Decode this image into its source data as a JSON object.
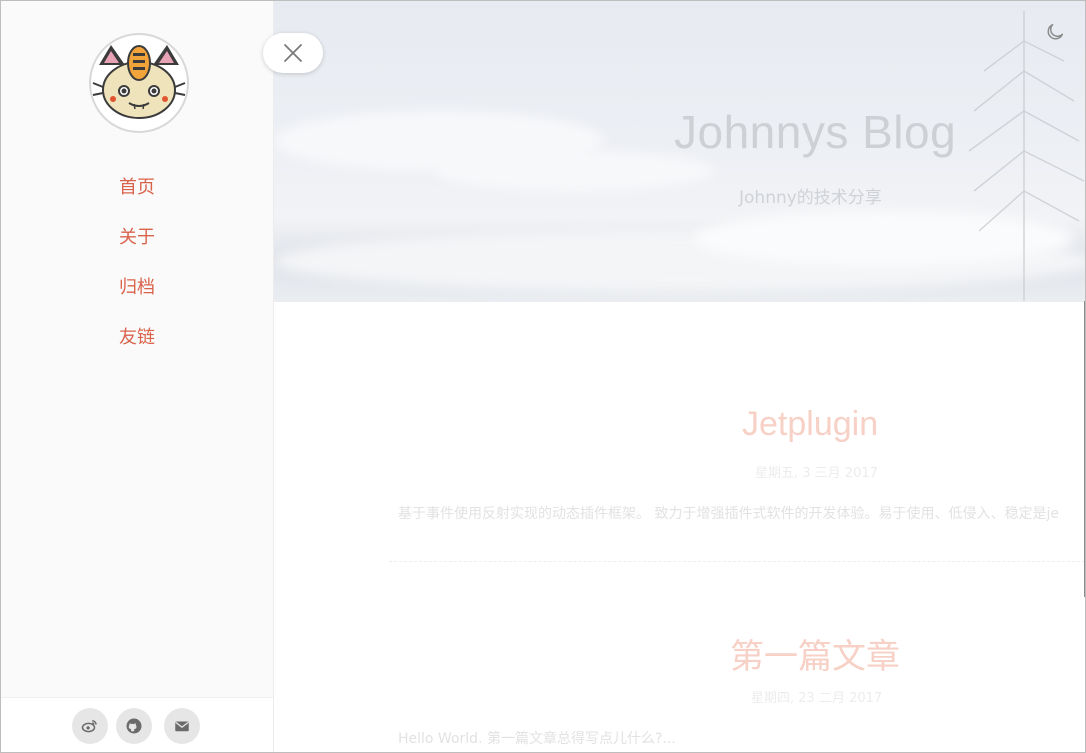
{
  "sidebar": {
    "nav": [
      {
        "label": "首页"
      },
      {
        "label": "关于"
      },
      {
        "label": "归档"
      },
      {
        "label": "友链"
      }
    ],
    "social": [
      "weibo-icon",
      "github-icon",
      "mail-icon"
    ]
  },
  "header": {
    "title": "Johnnys Blog",
    "subtitle": "Johnny的技术分享"
  },
  "posts": [
    {
      "title": "Jetplugin",
      "date": "星期五, 3 三月 2017",
      "excerpt": "基于事件使用反射实现的动态插件框架。 致力于增强插件式软件的开发体验。易于使用、低侵入、稳定是je"
    },
    {
      "title": "第一篇文章",
      "date": "星期四, 23 二月 2017",
      "excerpt": "Hello World. 第一篇文章总得写点儿什么?..."
    }
  ],
  "colors": {
    "nav_link": "#d9634a",
    "post_title": "#f7d0c6"
  }
}
